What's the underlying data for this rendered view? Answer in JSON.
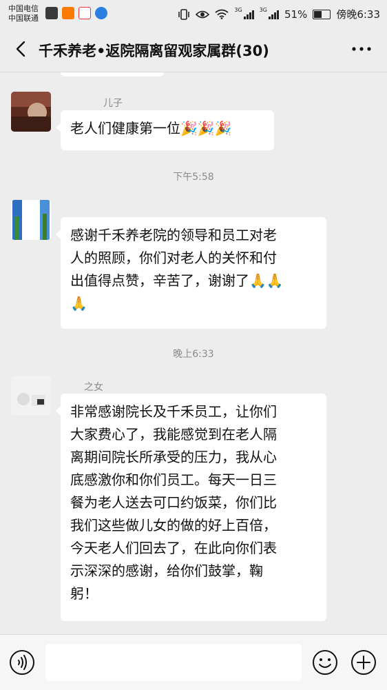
{
  "status": {
    "carrier_1": "中国电信",
    "carrier_2": "中国联通",
    "net_1": "3G",
    "net_2": "3G",
    "battery": "51%",
    "time": "傍晚6:33"
  },
  "header": {
    "title": "千禾养老•返院隔离留观家属群(30)"
  },
  "messages": {
    "m1": {
      "sender": "儿子",
      "text": "老人们健康第一位",
      "emoji": "🎉🎉🎉"
    },
    "ts1": "下午5:58",
    "m2": {
      "line1": "感谢千禾养老院的领导和员工对老",
      "line2": "人的照顾，你们对老人的关怀和付",
      "line3": "出值得点赞，辛苦了，谢谢了",
      "emoji_a": "🙏🙏",
      "emoji_b": "🙏"
    },
    "ts2": "晚上6:33",
    "m3": {
      "sender": "之女",
      "lines": [
        "非常感谢院长及千禾员工，让你们",
        "大家费心了，我能感觉到在老人隔",
        "离期间院长所承受的压力，我从心",
        "底感激你和你们员工。每天一日三",
        "餐为老人送去可口约饭菜，你们比",
        "我们这些做儿女的做的好上百倍，",
        "今天老人们回去了，在此向你们表",
        "示深深的感谢，给你们鼓掌，鞠",
        "躬！"
      ]
    }
  },
  "icons": {
    "back": "back-arrow-icon",
    "more": "more-dots-icon",
    "voice": "voice-input-icon",
    "emoji": "emoji-icon",
    "plus": "plus-icon"
  },
  "colors": {
    "background": "#ededed",
    "bubble": "#ffffff",
    "timestamp": "#8a8a8a"
  }
}
